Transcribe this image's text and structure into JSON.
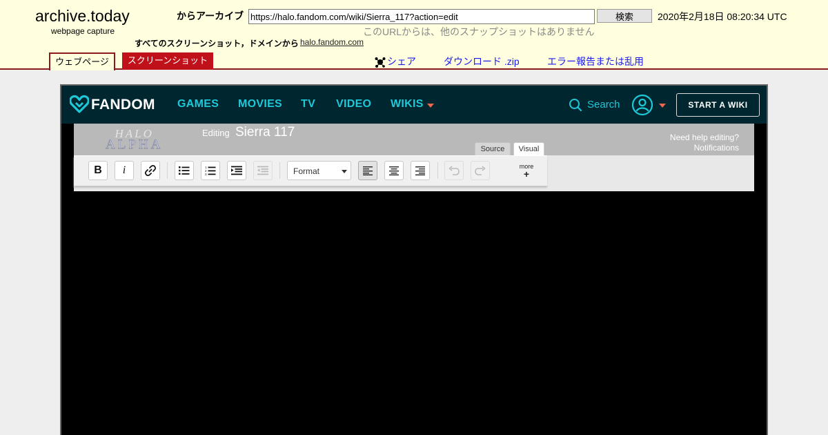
{
  "archive": {
    "site_title": "archive.today",
    "site_subtitle": "webpage capture",
    "from_label": "からアーカイブ",
    "url_value": "https://halo.fandom.com/wiki/Sierra_117?action=edit",
    "search_button": "検索",
    "capture_date": "2020年2月18日 08:20:34 UTC",
    "no_snapshots": "このURLからは、他のスナップショットはありません",
    "all_screenshots": "すべてのスクリーンショット，ドメインから",
    "domain": "halo.fandom.com",
    "tabs": {
      "webpage": "ウェブページ",
      "screenshot": "スクリーンショット"
    },
    "links": {
      "share": "シェア",
      "download": "ダウンロード .zip",
      "report": "エラー報告または乱用"
    },
    "colors": {
      "header_bg": "#ffffe0",
      "accent": "#8b1a1a",
      "tab_red": "#c0101a",
      "link": "#1a1aee"
    }
  },
  "fandom": {
    "logo_text": "FANDOM",
    "nav": {
      "games": "GAMES",
      "movies": "MOVIES",
      "tv": "TV",
      "video": "VIDEO",
      "wikis": "WIKIS"
    },
    "search_label": "Search",
    "start_wiki": "START A WIKI",
    "colors": {
      "nav_bg": "#00262f",
      "nav_link": "#1fc8d8",
      "caret": "#ee6650"
    }
  },
  "editor": {
    "wiki_logo_line1": "HALO",
    "wiki_logo_line2": "ALPHA",
    "editing_label": "Editing",
    "page_name": "Sierra 117",
    "help_link": "Need help editing?",
    "notifications_link": "Notifications",
    "mode_tabs": {
      "source": "Source",
      "visual": "Visual"
    },
    "toolbar": {
      "bold": "B",
      "italic": "i",
      "format": "Format",
      "more": "more",
      "more_plus": "+"
    }
  }
}
